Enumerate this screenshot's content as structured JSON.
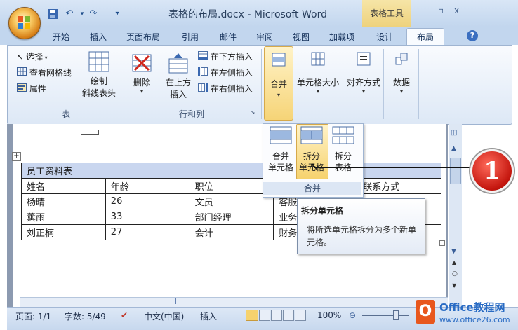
{
  "window": {
    "doc_title": "表格的布局.docx - Microsoft Word",
    "context_tab_title": "表格工具",
    "controls": [
      "-",
      "▫",
      "x"
    ]
  },
  "tabs": [
    "开始",
    "插入",
    "页面布局",
    "引用",
    "邮件",
    "审阅",
    "视图",
    "加载项",
    "设计",
    "布局"
  ],
  "active_tab": "布局",
  "ribbon": {
    "table_group": {
      "label": "表",
      "select": "选择",
      "view_gridlines": "查看网格线",
      "properties": "属性",
      "draw_diagonal_line1": "绘制",
      "draw_diagonal_line2": "斜线表头"
    },
    "rows_cols_group": {
      "label": "行和列",
      "delete": "删除",
      "insert_above_line1": "在上方",
      "insert_above_line2": "插入",
      "insert_below": "在下方插入",
      "insert_left": "在左侧插入",
      "insert_right": "在右侧插入"
    },
    "merge": "合并",
    "cell_size": "单元格大小",
    "alignment": "对齐方式",
    "data": "数据"
  },
  "merge_gallery": {
    "items": [
      {
        "line1": "合并",
        "line2": "单元格"
      },
      {
        "line1": "拆分",
        "line2": "单元格"
      },
      {
        "line1": "拆分",
        "line2": "表格"
      }
    ],
    "group_label": "合并"
  },
  "tooltip": {
    "title": "拆分单元格",
    "body": "将所选单元格拆分为多个新单元格。"
  },
  "table": {
    "title": "员工资料表",
    "headers": [
      "姓名",
      "年龄",
      "职位",
      "",
      "联系方式"
    ],
    "rows": [
      [
        "杨晴",
        "26",
        "文员",
        "客服",
        ""
      ],
      [
        "薰雨",
        "33",
        "部门经理",
        "业务",
        ""
      ],
      [
        "刘正楠",
        "27",
        "会计",
        "财务",
        ""
      ]
    ]
  },
  "callout_number": "1",
  "statusbar": {
    "page": "页面: 1/1",
    "words": "字数: 5/49",
    "language": "中文(中国)",
    "mode": "插入",
    "zoom": "100%"
  },
  "watermark": {
    "brand": "Office教程网",
    "url": "www.office26.com"
  },
  "colors": {
    "ribbon_bg": "#dde8f6",
    "highlight": "#f6d26e",
    "table_header": "#c9d6ef",
    "callout": "#c4160e"
  }
}
